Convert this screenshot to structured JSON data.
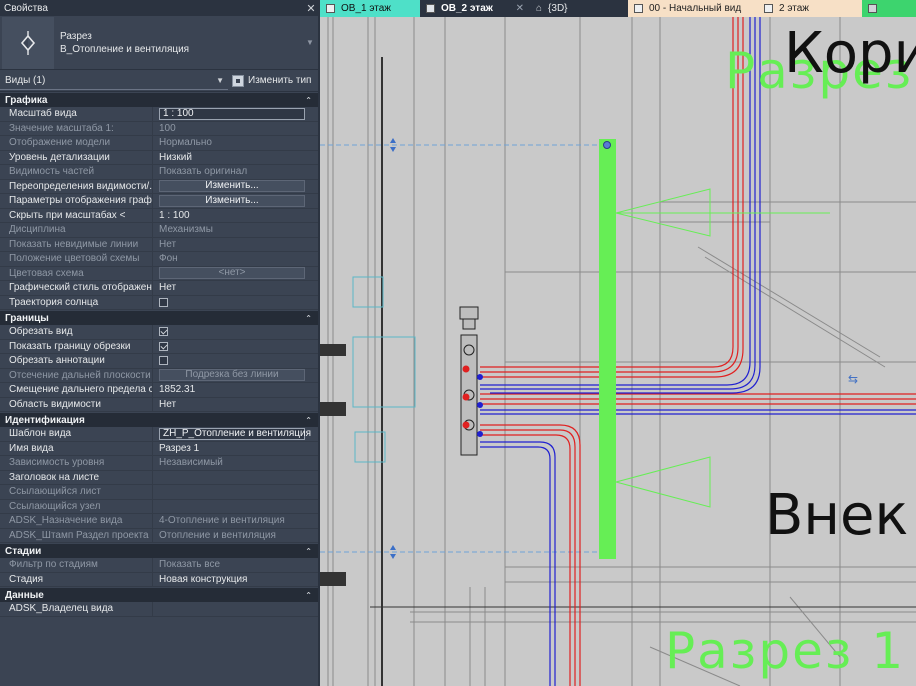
{
  "panel": {
    "title": "Свойства",
    "type_family": "Разрез",
    "type_name": "В_Отопление и вентиляция",
    "views_selector": "Виды (1)",
    "edit_type_label": "Изменить тип",
    "sections": [
      {
        "title": "Графика",
        "rows": [
          {
            "key": "Масштаб вида",
            "value": "1 : 100",
            "kind": "field",
            "dim": false
          },
          {
            "key": "Значение масштаба    1:",
            "value": "100",
            "kind": "text",
            "dim": true
          },
          {
            "key": "Отображение модели",
            "value": "Нормально",
            "kind": "text",
            "dim": true
          },
          {
            "key": "Уровень детализации",
            "value": "Низкий",
            "kind": "text",
            "dim": false
          },
          {
            "key": "Видимость частей",
            "value": "Показать оригинал",
            "kind": "text",
            "dim": true
          },
          {
            "key": "Переопределения видимости/...",
            "value": "Изменить...",
            "kind": "button",
            "dim": false
          },
          {
            "key": "Параметры отображения граф...",
            "value": "Изменить...",
            "kind": "button",
            "dim": false
          },
          {
            "key": "Скрыть при масштабах <",
            "value": "1 : 100",
            "kind": "text",
            "dim": false
          },
          {
            "key": "Дисциплина",
            "value": "Механизмы",
            "kind": "text",
            "dim": true
          },
          {
            "key": "Показать невидимые линии",
            "value": "Нет",
            "kind": "text",
            "dim": true
          },
          {
            "key": "Положение цветовой схемы",
            "value": "Фон",
            "kind": "text",
            "dim": true
          },
          {
            "key": "Цветовая схема",
            "value": "<нет>",
            "kind": "button",
            "dim": true
          },
          {
            "key": "Графический стиль отображен...",
            "value": "Нет",
            "kind": "text",
            "dim": false
          },
          {
            "key": "Траектория солнца",
            "value": "",
            "kind": "checkbox",
            "checked": false,
            "dim": false
          }
        ]
      },
      {
        "title": "Границы",
        "rows": [
          {
            "key": "Обрезать вид",
            "value": "",
            "kind": "checkbox",
            "checked": true,
            "dim": false
          },
          {
            "key": "Показать границу обрезки",
            "value": "",
            "kind": "checkbox",
            "checked": true,
            "dim": false
          },
          {
            "key": "Обрезать аннотации",
            "value": "",
            "kind": "checkbox",
            "checked": false,
            "dim": false
          },
          {
            "key": "Отсечение дальней плоскости",
            "value": "Подрезка без линии",
            "kind": "button",
            "dim": true
          },
          {
            "key": "Смещение дальнего предела с...",
            "value": "1852.31",
            "kind": "text",
            "dim": false
          },
          {
            "key": "Область видимости",
            "value": "Нет",
            "kind": "text",
            "dim": false
          }
        ]
      },
      {
        "title": "Идентификация",
        "rows": [
          {
            "key": "Шаблон вида",
            "value": "ZH_P_Отопление и вентиляция",
            "kind": "field",
            "dim": false
          },
          {
            "key": "Имя вида",
            "value": "Разрез 1",
            "kind": "text",
            "dim": false
          },
          {
            "key": "Зависимость уровня",
            "value": "Независимый",
            "kind": "text",
            "dim": true
          },
          {
            "key": "Заголовок на листе",
            "value": "",
            "kind": "text",
            "dim": false
          },
          {
            "key": "Ссылающийся лист",
            "value": "",
            "kind": "text",
            "dim": true
          },
          {
            "key": "Ссылающийся узел",
            "value": "",
            "kind": "text",
            "dim": true
          },
          {
            "key": "ADSK_Назначение вида",
            "value": "4-Отопление и вентиляция",
            "kind": "text",
            "dim": true
          },
          {
            "key": "ADSK_Штамп Раздел проекта",
            "value": "Отопление и вентиляция",
            "kind": "text",
            "dim": true
          }
        ]
      },
      {
        "title": "Стадии",
        "rows": [
          {
            "key": "Фильтр по стадиям",
            "value": "Показать все",
            "kind": "text",
            "dim": true
          },
          {
            "key": "Стадия",
            "value": "Новая конструкция",
            "kind": "text",
            "dim": false
          }
        ]
      },
      {
        "title": "Данные",
        "rows": [
          {
            "key": "ADSK_Владелец вида",
            "value": "",
            "kind": "text",
            "dim": false
          }
        ]
      }
    ]
  },
  "tabs": [
    {
      "label": "ОВ_1 этаж",
      "active": false
    },
    {
      "label": "ОВ_2 этаж",
      "active": true
    },
    {
      "label": "{3D}",
      "active": false
    },
    {
      "label": "00 - Начальный вид",
      "active": false
    },
    {
      "label": "2 этаж",
      "active": false
    },
    {
      "label": "",
      "active": false
    }
  ],
  "canvas": {
    "label_top_black": "Кори",
    "label_top_green": "Разрез",
    "label_mid_black": "Внек",
    "label_bottom_green": "Разрез 1",
    "colors": {
      "background": "#c9c9c9",
      "supply": "#e02020",
      "return": "#2020d0",
      "section_line": "#66ee55"
    }
  }
}
